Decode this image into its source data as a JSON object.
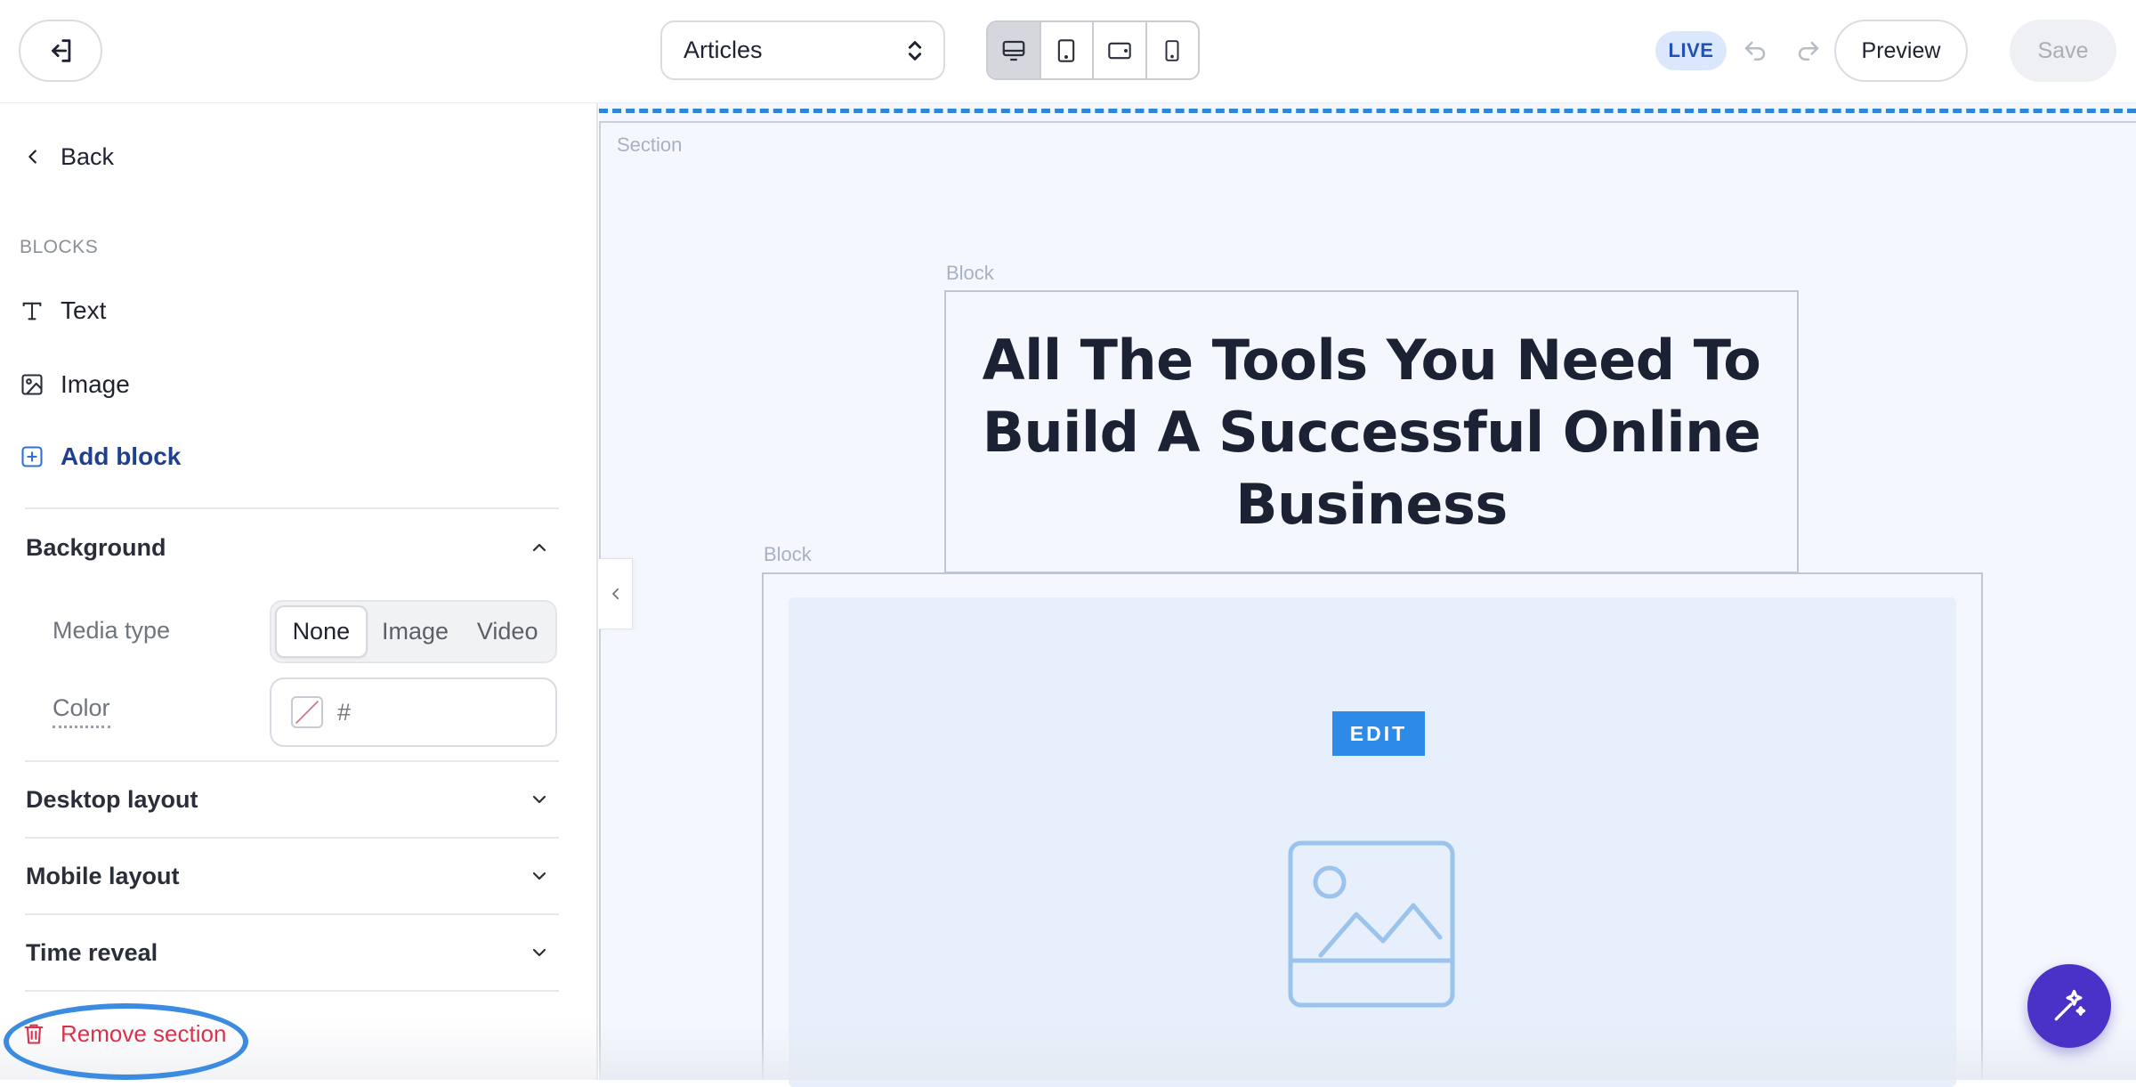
{
  "topbar": {
    "page_select": "Articles",
    "devices": [
      "desktop-icon",
      "tablet-portrait-icon",
      "tablet-landscape-icon",
      "mobile-icon"
    ],
    "active_device": "desktop",
    "live_badge": "LIVE",
    "preview_label": "Preview",
    "save_label": "Save"
  },
  "sidebar": {
    "back_label": "Back",
    "blocks_heading": "BLOCKS",
    "blocks": [
      {
        "label": "Text",
        "icon": "text-icon"
      },
      {
        "label": "Image",
        "icon": "image-icon"
      }
    ],
    "add_block_label": "Add block",
    "background": {
      "title": "Background",
      "media_type_label": "Media type",
      "media_options": [
        "None",
        "Image",
        "Video"
      ],
      "media_selected": "None",
      "color_label": "Color",
      "color_value": "#"
    },
    "sections": [
      {
        "title": "Desktop layout"
      },
      {
        "title": "Mobile layout"
      },
      {
        "title": "Time reveal"
      }
    ],
    "remove_section_label": "Remove section"
  },
  "canvas": {
    "section_tag": "Section",
    "block_tag_1": "Block",
    "block_tag_2": "Block",
    "headline": "All The Tools You Need To Build A Successful Online Business",
    "edit_label": "EDIT"
  },
  "colors": {
    "accent": "#2d8ae6",
    "danger": "#d9324a",
    "add_block": "#1f3f8f",
    "live_bg": "#dbe7fb",
    "fab": "#4a32c9"
  }
}
